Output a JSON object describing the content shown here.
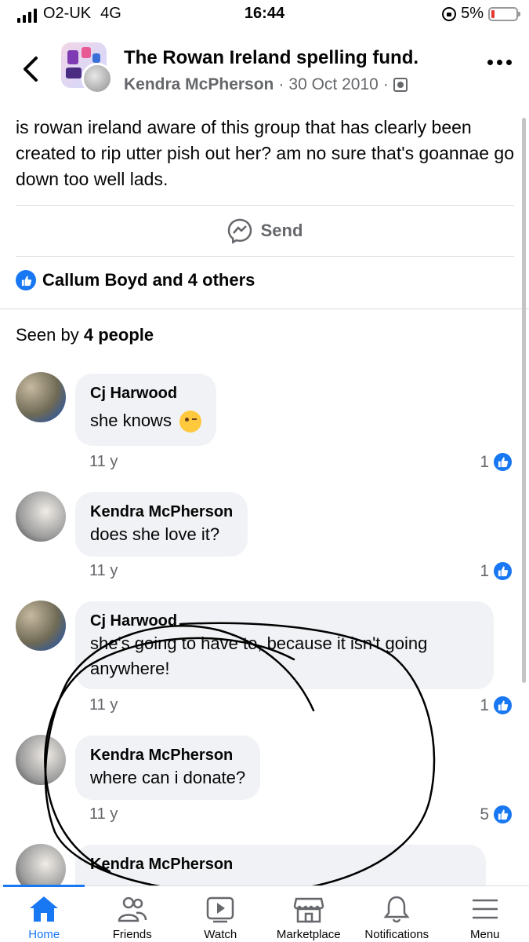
{
  "status_bar": {
    "carrier": "O2-UK",
    "network": "4G",
    "time": "16:44",
    "battery": "5%"
  },
  "header": {
    "group_name": "The Rowan Ireland spelling fund.",
    "author": "Kendra McPherson",
    "date": "30 Oct 2010",
    "separator": "·"
  },
  "post": {
    "text": "is rowan ireland aware of this group that has clearly been created to rip utter pish out her? am no sure that's goannae go down too well lads.",
    "send_label": "Send",
    "likes_label": "Callum Boyd and 4 others",
    "seen_prefix": "Seen by",
    "seen_count": "4 people"
  },
  "comments": [
    {
      "name": "Cj Harwood",
      "text": "she knows",
      "time": "11 y",
      "likes": "1"
    },
    {
      "name": "Kendra McPherson",
      "text": "does she love it?",
      "time": "11 y",
      "likes": "1"
    },
    {
      "name": "Cj Harwood",
      "text": "she's going to have to, because it isn't going anywhere!",
      "time": "11 y",
      "likes": "1"
    },
    {
      "name": "Kendra McPherson",
      "text": "where can i donate?",
      "time": "11 y",
      "likes": "5"
    },
    {
      "name": "Kendra McPherson",
      "text": "",
      "time": "",
      "likes": ""
    }
  ],
  "nav": {
    "home": "Home",
    "friends": "Friends",
    "watch": "Watch",
    "marketplace": "Marketplace",
    "notifications": "Notifications",
    "menu": "Menu"
  },
  "colors": {
    "accent": "#1877f2",
    "bubble": "#f0f2f5",
    "muted_text": "#65676b"
  }
}
